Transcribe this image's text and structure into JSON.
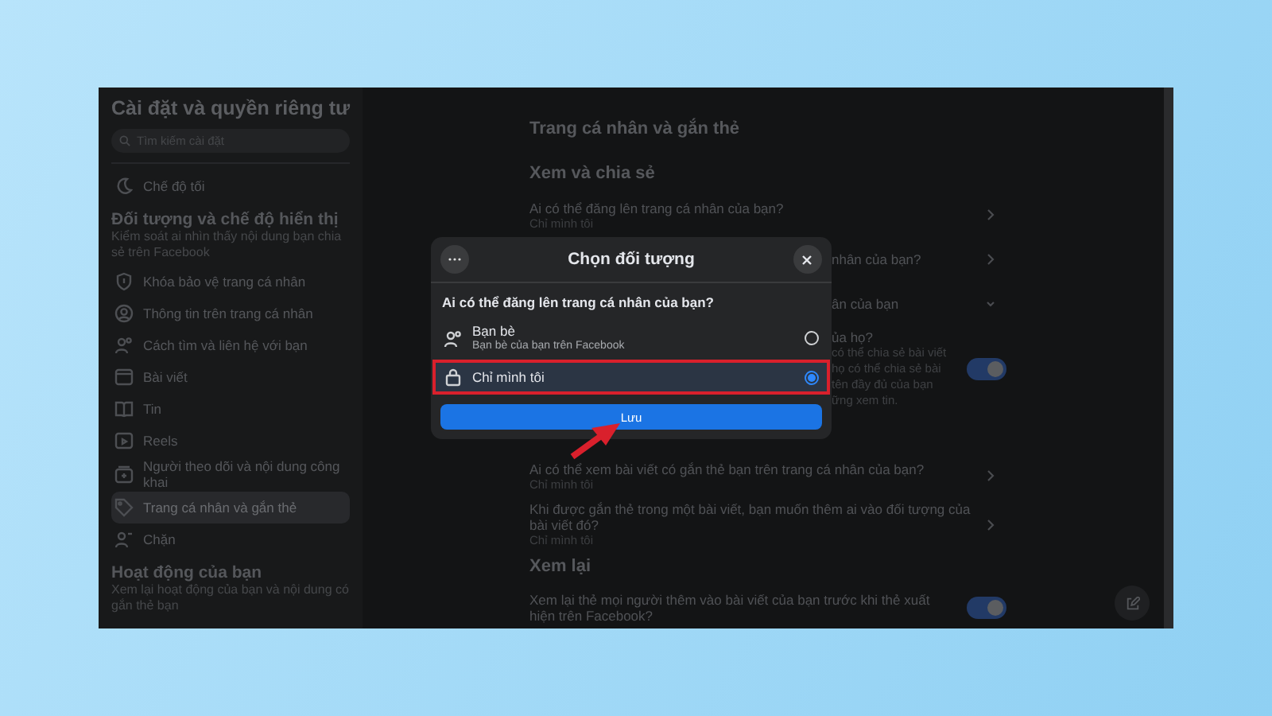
{
  "sidebar": {
    "title": "Cài đặt và quyền riêng tư",
    "search": {
      "placeholder": "Tìm kiếm cài đặt"
    },
    "sections": [
      {
        "items": [
          {
            "label": "Chế độ tối",
            "selected": false
          }
        ]
      },
      {
        "heading": "Đối tượng và chế độ hiển thị",
        "description": "Kiểm soát ai nhìn thấy nội dung bạn chia sẻ trên Facebook",
        "items": [
          {
            "label": "Khóa bảo vệ trang cá nhân",
            "selected": false
          },
          {
            "label": "Thông tin trên trang cá nhân",
            "selected": false
          },
          {
            "label": "Cách tìm và liên hệ với bạn",
            "selected": false
          },
          {
            "label": "Bài viết",
            "selected": false
          },
          {
            "label": "Tin",
            "selected": false
          },
          {
            "label": "Reels",
            "selected": false
          },
          {
            "label": "Người theo dõi và nội dung công khai",
            "selected": false
          },
          {
            "label": "Trang cá nhân và gắn thẻ",
            "selected": true
          },
          {
            "label": "Chặn",
            "selected": false
          }
        ]
      },
      {
        "heading": "Hoạt động của bạn",
        "description": "Xem lại hoạt động của bạn và nội dung có gắn thẻ bạn"
      }
    ]
  },
  "main": {
    "rows": [
      {
        "kind": "title",
        "label": "Trang cá nhân và gắn thẻ"
      },
      {
        "kind": "heading",
        "label": "Xem và chia sẻ"
      },
      {
        "kind": "setting",
        "label": "Ai có thể đăng lên trang cá nhân của bạn?",
        "value": "Chỉ mình tôi",
        "control": {
          "kind": "chevron"
        }
      },
      {
        "kind": "partial",
        "lines": [
          "nhân của bạn?"
        ],
        "control": {
          "kind": "chevron"
        }
      },
      {
        "kind": "partial",
        "lines": [
          "ân của bạn"
        ],
        "control": {
          "kind": "expand"
        }
      },
      {
        "kind": "partial",
        "lines": [
          "ủa họ?",
          "có thể chia sẻ bài viết",
          "họ có thể chia sẻ bài",
          "tên đầy đủ của bạn",
          "ững xem tin."
        ],
        "control": {
          "kind": "toggle",
          "on": true
        }
      },
      {
        "kind": "setting",
        "label": "Ai có thể xem bài viết có gắn thẻ bạn trên trang cá nhân của bạn?",
        "value": "Chỉ mình tôi",
        "control": {
          "kind": "chevron"
        }
      },
      {
        "kind": "setting",
        "label": "Khi được gắn thẻ trong một bài viết, bạn muốn thêm ai vào đối tượng của bài viết đó?",
        "value": "Chỉ mình tôi",
        "control": {
          "kind": "chevron"
        }
      },
      {
        "kind": "heading",
        "label": "Xem lại"
      },
      {
        "kind": "setting",
        "label": "Xem lại thẻ mọi người thêm vào bài viết của bạn trước khi thẻ xuất hiện trên Facebook?",
        "control": {
          "kind": "toggle",
          "on": true
        }
      }
    ]
  },
  "dialog": {
    "title": "Chọn đối tượng",
    "question": "Ai có thể đăng lên trang cá nhân của bạn?",
    "options": [
      {
        "label": "Bạn bè",
        "sublabel": "Bạn bè của bạn trên Facebook",
        "selected": false,
        "highlighted": false
      },
      {
        "label": "Chỉ mình tôi",
        "selected": true,
        "highlighted": true
      }
    ],
    "button": "Lưu"
  }
}
